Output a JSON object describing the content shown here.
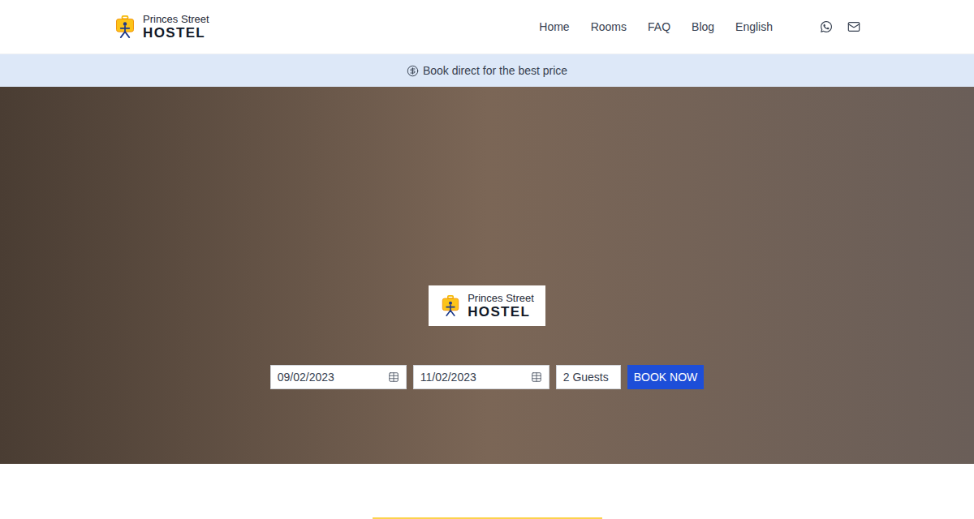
{
  "header": {
    "logo": {
      "line1": "Princes Street",
      "line2": "HOSTEL"
    },
    "nav": [
      {
        "label": "Home"
      },
      {
        "label": "Rooms"
      },
      {
        "label": "FAQ"
      },
      {
        "label": "Blog"
      },
      {
        "label": "English"
      }
    ]
  },
  "banner": {
    "text": "Book direct for the best price"
  },
  "hero": {
    "logo": {
      "line1": "Princes Street",
      "line2": "HOSTEL"
    },
    "booking": {
      "check_in": "09/02/2023",
      "check_out": "11/02/2023",
      "guests": "2 Guests",
      "button": "BOOK NOW"
    }
  }
}
